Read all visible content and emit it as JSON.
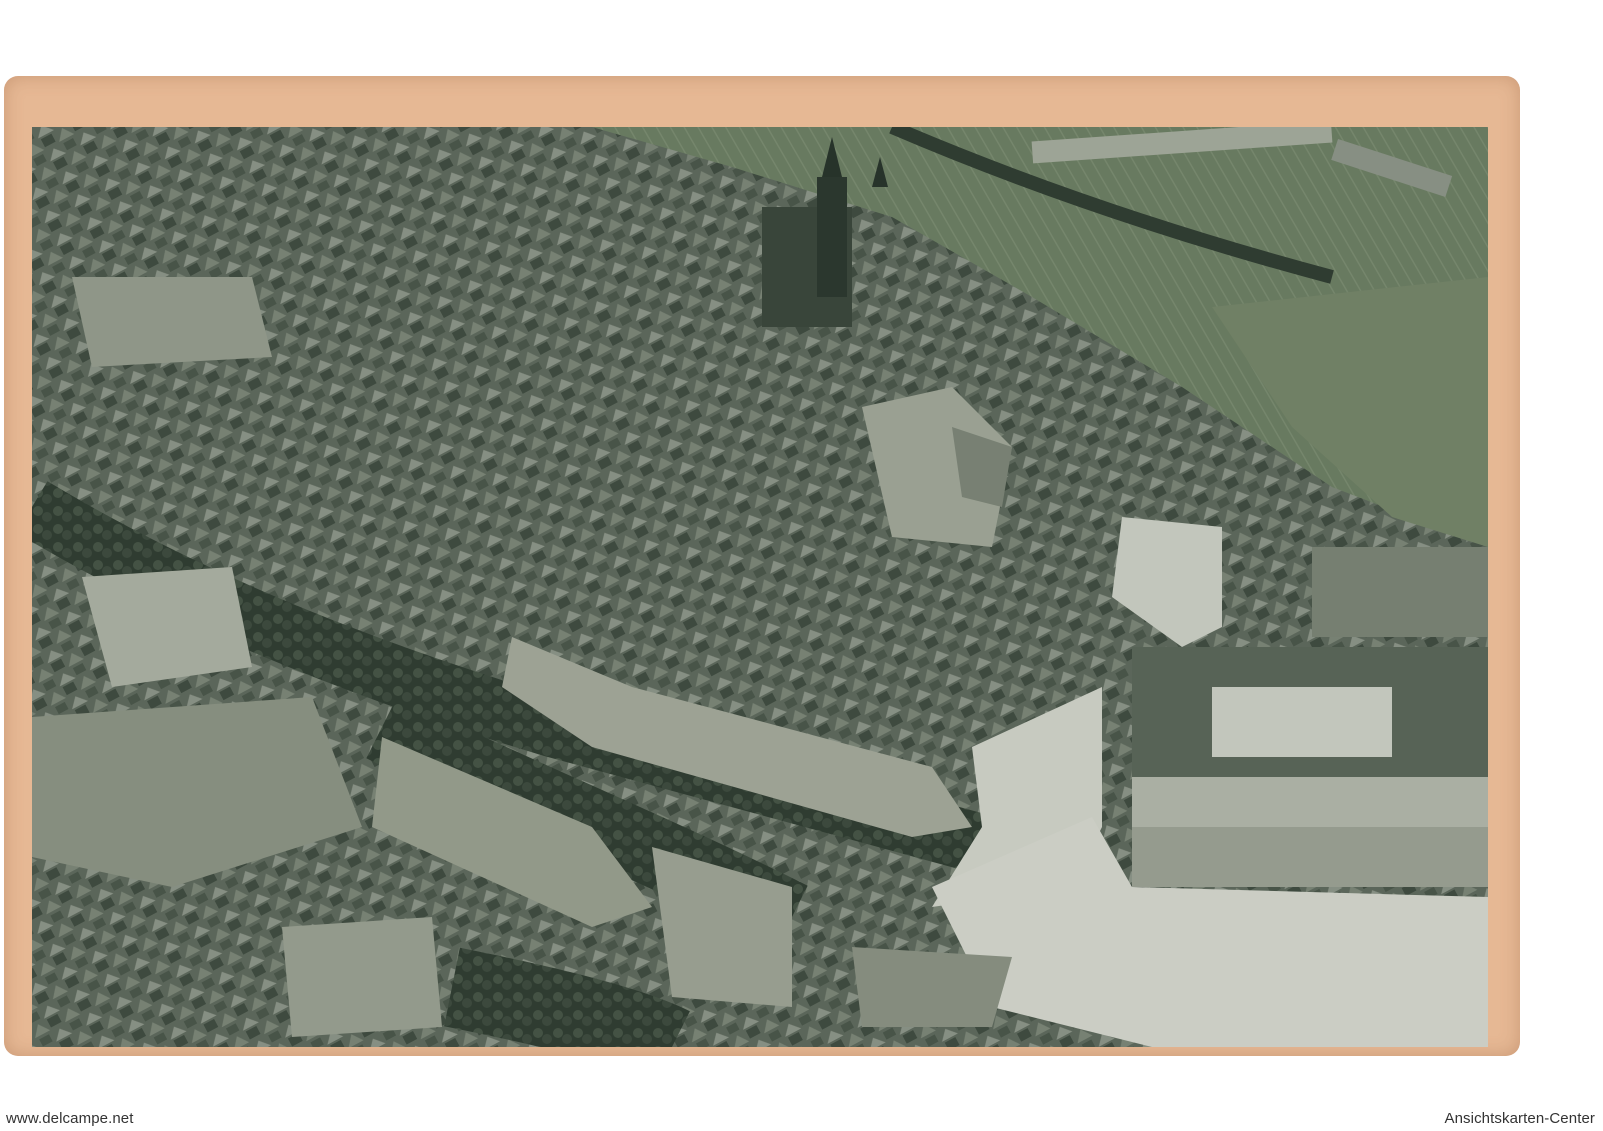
{
  "watermarks": {
    "left": "www.delcampe.net",
    "right": "Ansichtskarten-Center"
  },
  "colors": {
    "card": "#e6b894",
    "photo_dark": "#3c4a3d",
    "photo_mid": "#6d786c",
    "photo_light": "#c9cdc2",
    "lawn": "#6b7d62"
  },
  "subject": "aerial-view-postcard"
}
